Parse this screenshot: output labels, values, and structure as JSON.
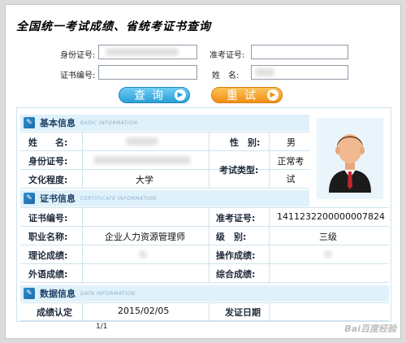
{
  "page_title": "全国统一考试成绩、省统考证书查询",
  "form": {
    "id_card_label": "身份证号:",
    "admission_no_label": "准考证号:",
    "cert_no_label": "证书编号:",
    "name_label": "姓　名:",
    "search_button": "查询",
    "reset_button": "重试"
  },
  "basic_info": {
    "title": "基本信息",
    "subtitle": "BASIC INFORMATION",
    "name_key": "姓　　名:",
    "gender_key": "性　别:",
    "gender_value": "男",
    "id_key": "身份证号:",
    "exam_type_key": "考试类型:",
    "exam_type_value": "正常考试",
    "education_key": "文化程度:",
    "education_value": "大学"
  },
  "cert_info": {
    "title": "证书信息",
    "subtitle": "CERTIFICATE INFORMATION",
    "cert_no_key": "证书编号:",
    "admission_key": "准考证号:",
    "admission_value": "1411232200000007824",
    "job_key": "职业名称:",
    "job_value": "企业人力资源管理师",
    "level_key": "级　别:",
    "level_value": "三级",
    "theory_key": "理论成绩:",
    "operation_key": "操作成绩:",
    "language_key": "外语成绩:",
    "composite_key": "综合成绩:"
  },
  "data_info": {
    "title": "数据信息",
    "subtitle": "DATA INFORMATION",
    "score_date_key": "成绩认定",
    "score_date_value": "2015/02/05",
    "cert_date_key": "发证日期"
  },
  "pager": "1/1",
  "watermark": "Bai百度经验"
}
